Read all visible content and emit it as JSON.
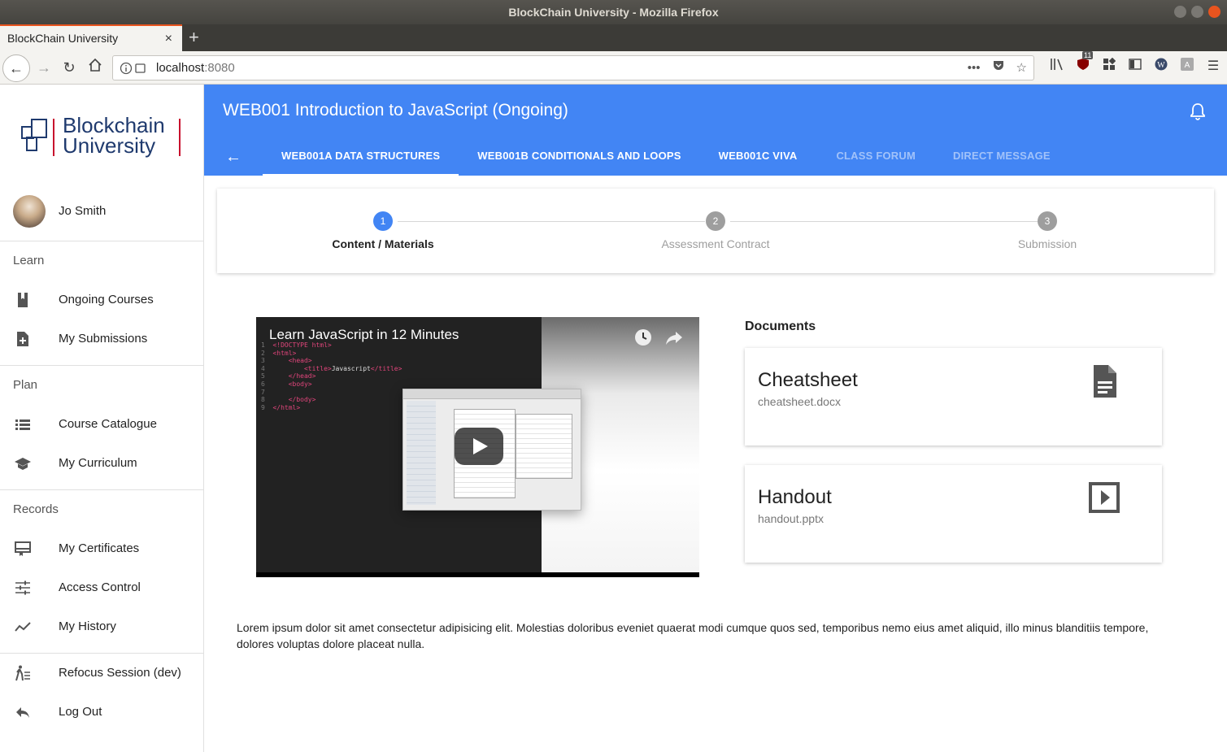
{
  "window": {
    "title": "BlockChain University - Mozilla Firefox"
  },
  "browser": {
    "tab_title": "BlockChain University",
    "tab_close": "×",
    "new_tab": "+",
    "url_host": "localhost",
    "url_port": ":8080",
    "url_more": "•••",
    "ext_badge": "11"
  },
  "sidebar": {
    "logo_line1": "Blockchain",
    "logo_line2": "University",
    "user_name": "Jo Smith",
    "sections": {
      "learn": "Learn",
      "plan": "Plan",
      "records": "Records"
    },
    "items": {
      "ongoing_courses": "Ongoing Courses",
      "my_submissions": "My Submissions",
      "course_catalogue": "Course Catalogue",
      "my_curriculum": "My Curriculum",
      "my_certificates": "My Certificates",
      "access_control": "Access Control",
      "my_history": "My History",
      "refocus_session": "Refocus Session (dev)",
      "log_out": "Log Out"
    }
  },
  "header": {
    "title": "WEB001 Introduction to JavaScript (Ongoing)",
    "back_arrow": "←",
    "tabs": [
      {
        "label": "WEB001A DATA STRUCTURES"
      },
      {
        "label": "WEB001B CONDITIONALS AND LOOPS"
      },
      {
        "label": "WEB001C VIVA"
      },
      {
        "label": "CLASS FORUM"
      },
      {
        "label": "DIRECT MESSAGE"
      }
    ]
  },
  "stepper": {
    "steps": [
      {
        "number": "1",
        "label": "Content / Materials"
      },
      {
        "number": "2",
        "label": "Assessment Contract"
      },
      {
        "number": "3",
        "label": "Submission"
      }
    ]
  },
  "video": {
    "title": "Learn JavaScript in 12 Minutes"
  },
  "documents": {
    "heading": "Documents",
    "items": [
      {
        "title": "Cheatsheet",
        "file": "cheatsheet.docx",
        "icon": "document-icon"
      },
      {
        "title": "Handout",
        "file": "handout.pptx",
        "icon": "slideshow-icon"
      }
    ]
  },
  "description": "Lorem ipsum dolor sit amet consectetur adipisicing elit. Molestias doloribus eveniet quaerat modi cumque quos sed, temporibus nemo eius amet aliquid, illo minus blanditiis tempore, dolores voluptas dolore placeat nulla.",
  "colors": {
    "primary": "#4285f4",
    "logo_blue": "#1f3a6e",
    "logo_red": "#c8102e"
  }
}
